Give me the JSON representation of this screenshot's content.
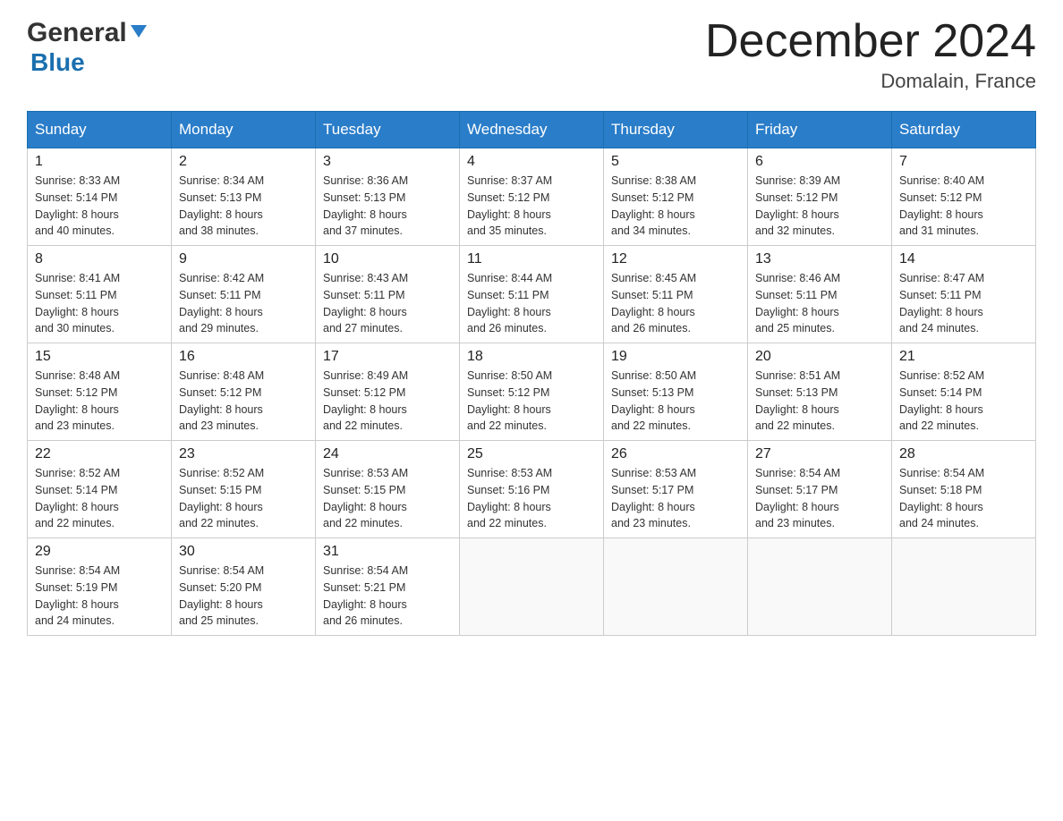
{
  "header": {
    "logo_general": "General",
    "logo_blue": "Blue",
    "month_title": "December 2024",
    "location": "Domalain, France"
  },
  "days_of_week": [
    "Sunday",
    "Monday",
    "Tuesday",
    "Wednesday",
    "Thursday",
    "Friday",
    "Saturday"
  ],
  "weeks": [
    [
      {
        "day": "1",
        "sunrise": "8:33 AM",
        "sunset": "5:14 PM",
        "daylight": "8 hours and 40 minutes."
      },
      {
        "day": "2",
        "sunrise": "8:34 AM",
        "sunset": "5:13 PM",
        "daylight": "8 hours and 38 minutes."
      },
      {
        "day": "3",
        "sunrise": "8:36 AM",
        "sunset": "5:13 PM",
        "daylight": "8 hours and 37 minutes."
      },
      {
        "day": "4",
        "sunrise": "8:37 AM",
        "sunset": "5:12 PM",
        "daylight": "8 hours and 35 minutes."
      },
      {
        "day": "5",
        "sunrise": "8:38 AM",
        "sunset": "5:12 PM",
        "daylight": "8 hours and 34 minutes."
      },
      {
        "day": "6",
        "sunrise": "8:39 AM",
        "sunset": "5:12 PM",
        "daylight": "8 hours and 32 minutes."
      },
      {
        "day": "7",
        "sunrise": "8:40 AM",
        "sunset": "5:12 PM",
        "daylight": "8 hours and 31 minutes."
      }
    ],
    [
      {
        "day": "8",
        "sunrise": "8:41 AM",
        "sunset": "5:11 PM",
        "daylight": "8 hours and 30 minutes."
      },
      {
        "day": "9",
        "sunrise": "8:42 AM",
        "sunset": "5:11 PM",
        "daylight": "8 hours and 29 minutes."
      },
      {
        "day": "10",
        "sunrise": "8:43 AM",
        "sunset": "5:11 PM",
        "daylight": "8 hours and 27 minutes."
      },
      {
        "day": "11",
        "sunrise": "8:44 AM",
        "sunset": "5:11 PM",
        "daylight": "8 hours and 26 minutes."
      },
      {
        "day": "12",
        "sunrise": "8:45 AM",
        "sunset": "5:11 PM",
        "daylight": "8 hours and 26 minutes."
      },
      {
        "day": "13",
        "sunrise": "8:46 AM",
        "sunset": "5:11 PM",
        "daylight": "8 hours and 25 minutes."
      },
      {
        "day": "14",
        "sunrise": "8:47 AM",
        "sunset": "5:11 PM",
        "daylight": "8 hours and 24 minutes."
      }
    ],
    [
      {
        "day": "15",
        "sunrise": "8:48 AM",
        "sunset": "5:12 PM",
        "daylight": "8 hours and 23 minutes."
      },
      {
        "day": "16",
        "sunrise": "8:48 AM",
        "sunset": "5:12 PM",
        "daylight": "8 hours and 23 minutes."
      },
      {
        "day": "17",
        "sunrise": "8:49 AM",
        "sunset": "5:12 PM",
        "daylight": "8 hours and 22 minutes."
      },
      {
        "day": "18",
        "sunrise": "8:50 AM",
        "sunset": "5:12 PM",
        "daylight": "8 hours and 22 minutes."
      },
      {
        "day": "19",
        "sunrise": "8:50 AM",
        "sunset": "5:13 PM",
        "daylight": "8 hours and 22 minutes."
      },
      {
        "day": "20",
        "sunrise": "8:51 AM",
        "sunset": "5:13 PM",
        "daylight": "8 hours and 22 minutes."
      },
      {
        "day": "21",
        "sunrise": "8:52 AM",
        "sunset": "5:14 PM",
        "daylight": "8 hours and 22 minutes."
      }
    ],
    [
      {
        "day": "22",
        "sunrise": "8:52 AM",
        "sunset": "5:14 PM",
        "daylight": "8 hours and 22 minutes."
      },
      {
        "day": "23",
        "sunrise": "8:52 AM",
        "sunset": "5:15 PM",
        "daylight": "8 hours and 22 minutes."
      },
      {
        "day": "24",
        "sunrise": "8:53 AM",
        "sunset": "5:15 PM",
        "daylight": "8 hours and 22 minutes."
      },
      {
        "day": "25",
        "sunrise": "8:53 AM",
        "sunset": "5:16 PM",
        "daylight": "8 hours and 22 minutes."
      },
      {
        "day": "26",
        "sunrise": "8:53 AM",
        "sunset": "5:17 PM",
        "daylight": "8 hours and 23 minutes."
      },
      {
        "day": "27",
        "sunrise": "8:54 AM",
        "sunset": "5:17 PM",
        "daylight": "8 hours and 23 minutes."
      },
      {
        "day": "28",
        "sunrise": "8:54 AM",
        "sunset": "5:18 PM",
        "daylight": "8 hours and 24 minutes."
      }
    ],
    [
      {
        "day": "29",
        "sunrise": "8:54 AM",
        "sunset": "5:19 PM",
        "daylight": "8 hours and 24 minutes."
      },
      {
        "day": "30",
        "sunrise": "8:54 AM",
        "sunset": "5:20 PM",
        "daylight": "8 hours and 25 minutes."
      },
      {
        "day": "31",
        "sunrise": "8:54 AM",
        "sunset": "5:21 PM",
        "daylight": "8 hours and 26 minutes."
      },
      null,
      null,
      null,
      null
    ]
  ],
  "labels": {
    "sunrise": "Sunrise:",
    "sunset": "Sunset:",
    "daylight": "Daylight:"
  }
}
